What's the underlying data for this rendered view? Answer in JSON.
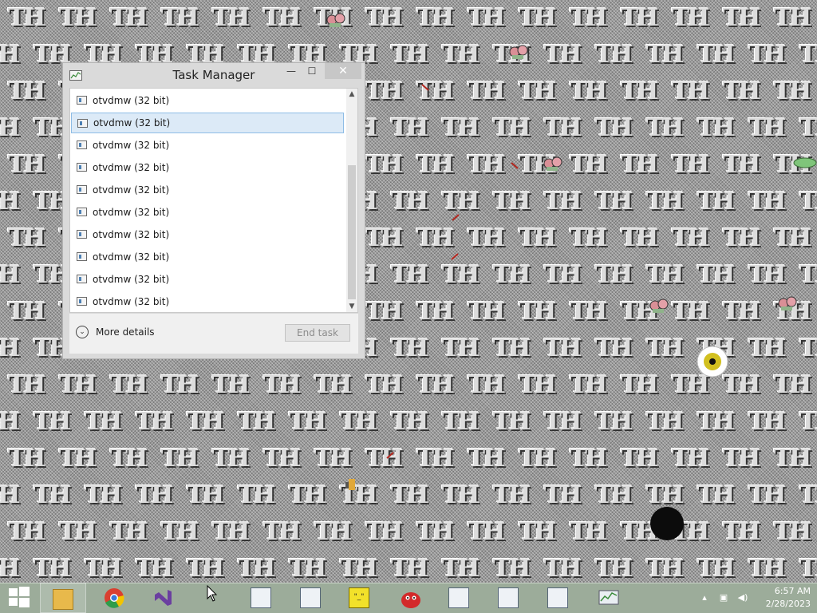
{
  "task_manager": {
    "title": "Task Manager",
    "controls": {
      "minimize": "—",
      "maximize": "☐",
      "close": "✕"
    },
    "processes": [
      "otvdmw (32 bit)",
      "otvdmw (32 bit)",
      "otvdmw (32 bit)",
      "otvdmw (32 bit)",
      "otvdmw (32 bit)",
      "otvdmw (32 bit)",
      "otvdmw (32 bit)",
      "otvdmw (32 bit)",
      "otvdmw (32 bit)",
      "otvdmw (32 bit)"
    ],
    "selected_index": 1,
    "more_details_label": "More details",
    "end_task_label": "End task"
  },
  "wallpaper": {
    "tile_text": "TH"
  },
  "taskbar": {
    "apps": [
      "file-explorer-icon",
      "chrome-icon",
      "visual-studio-icon",
      "window-icon",
      "window-icon",
      "yellow-face-icon",
      "red-creature-icon",
      "window-icon",
      "window-icon",
      "window-icon",
      "task-manager-icon"
    ],
    "clock": {
      "time": "6:57 AM",
      "date": "2/28/2023"
    }
  },
  "colors": {
    "selected_row_bg": "#dceaf7",
    "selected_row_border": "#8ebde6",
    "taskbar_bg": "#9cac9a",
    "titlebar_bg": "#dadada"
  }
}
